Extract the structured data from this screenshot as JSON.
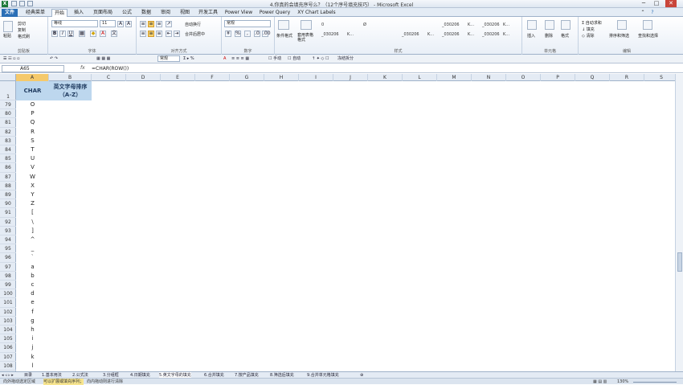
{
  "window": {
    "title": "4.你真的会填充序号么？（12个序号填充技巧） - Microsoft Excel",
    "minimize": "─",
    "maximize": "□",
    "close": "✕"
  },
  "tabs": [
    {
      "label": "文件"
    },
    {
      "label": "经典菜单"
    },
    {
      "label": "开始"
    },
    {
      "label": "插入"
    },
    {
      "label": "页面布局"
    },
    {
      "label": "公式"
    },
    {
      "label": "数据"
    },
    {
      "label": "审阅"
    },
    {
      "label": "视图"
    },
    {
      "label": "开发工具"
    },
    {
      "label": "Power View"
    },
    {
      "label": "Power Query"
    },
    {
      "label": "XY Chart Labels"
    }
  ],
  "ribbon": {
    "clipboard": {
      "paste": "粘贴",
      "cut": "剪切",
      "copy": "复制",
      "format_painter": "格式刷",
      "label": "剪贴板"
    },
    "font": {
      "name": "等线",
      "size": "11",
      "bold": "B",
      "italic": "I",
      "underline": "U",
      "label": "字体",
      "grow": "A",
      "shrink": "A"
    },
    "alignment": {
      "wrap": "自动换行",
      "merge": "合并后居中",
      "label": "对齐方式"
    },
    "number": {
      "format": "常规",
      "percent": "%",
      "comma": ",",
      "label": "数字"
    },
    "styles": {
      "conditional": "条件格式",
      "table": "套用表格格式",
      "label": "样式",
      "cells": [
        "0",
        "Ø",
        "_030206",
        "K...",
        "_030206",
        "K...",
        "_030206",
        "K...",
        "_030206",
        "K...",
        "_030206",
        "K...",
        "_030206",
        "K..."
      ]
    },
    "cells_group": {
      "insert": "插入",
      "delete": "删除",
      "format": "格式",
      "label": "单元格"
    },
    "editing": {
      "autosum": "自动求和",
      "fill": "填充",
      "clear": "清除",
      "sort": "排序和筛选",
      "find": "查找和选择",
      "label": "编辑"
    }
  },
  "toolbar2": {
    "format": "常规",
    "manual": "手动",
    "auto": "自动",
    "freeze": "冻结拆分"
  },
  "formula_bar": {
    "name_box": "A65",
    "fx": "fx",
    "formula": "=CHAR(ROW())"
  },
  "columns": [
    "A",
    "B",
    "C",
    "D",
    "E",
    "F",
    "G",
    "H",
    "I",
    "J",
    "K",
    "L",
    "M",
    "N",
    "O",
    "P",
    "Q",
    "R",
    "S"
  ],
  "header_row": {
    "row": "1",
    "a": "CHAR",
    "b": "英文字母排序（A-Z）"
  },
  "rows": [
    {
      "n": "79",
      "v": "O"
    },
    {
      "n": "80",
      "v": "P"
    },
    {
      "n": "81",
      "v": "Q"
    },
    {
      "n": "82",
      "v": "R"
    },
    {
      "n": "83",
      "v": "S"
    },
    {
      "n": "84",
      "v": "T"
    },
    {
      "n": "85",
      "v": "U"
    },
    {
      "n": "86",
      "v": "V"
    },
    {
      "n": "87",
      "v": "W"
    },
    {
      "n": "88",
      "v": "X"
    },
    {
      "n": "89",
      "v": "Y"
    },
    {
      "n": "90",
      "v": "Z"
    },
    {
      "n": "91",
      "v": "["
    },
    {
      "n": "92",
      "v": "\\"
    },
    {
      "n": "93",
      "v": "]"
    },
    {
      "n": "94",
      "v": "^"
    },
    {
      "n": "95",
      "v": "_"
    },
    {
      "n": "96",
      "v": "`"
    },
    {
      "n": "97",
      "v": "a"
    },
    {
      "n": "98",
      "v": "b"
    },
    {
      "n": "99",
      "v": "c"
    },
    {
      "n": "100",
      "v": "d"
    },
    {
      "n": "101",
      "v": "e"
    },
    {
      "n": "102",
      "v": "f"
    },
    {
      "n": "103",
      "v": "g"
    },
    {
      "n": "104",
      "v": "h"
    },
    {
      "n": "105",
      "v": "i"
    },
    {
      "n": "106",
      "v": "j"
    },
    {
      "n": "107",
      "v": "k"
    },
    {
      "n": "108",
      "v": "l"
    }
  ],
  "sheet_tabs": [
    {
      "label": "目录"
    },
    {
      "label": "1.基本用法"
    },
    {
      "label": "2.公式法"
    },
    {
      "label": "3.分组框"
    },
    {
      "label": "4.日期填充"
    },
    {
      "label": "5.英文字母的填充"
    },
    {
      "label": "6.合并填充"
    },
    {
      "label": "7.按产品填充"
    },
    {
      "label": "8.筛选后填充"
    },
    {
      "label": "9.合并单元格填充"
    }
  ],
  "status": {
    "s1": "向外拖动选定区域",
    "s2": "可以扩展或填充序列；",
    "s3": "向内拖动则进行清除",
    "zoom": "130%"
  },
  "colors": {
    "accent": "#2b6fb6",
    "header_fill": "#bdd7ee",
    "selected_header": "#f5c96b"
  }
}
